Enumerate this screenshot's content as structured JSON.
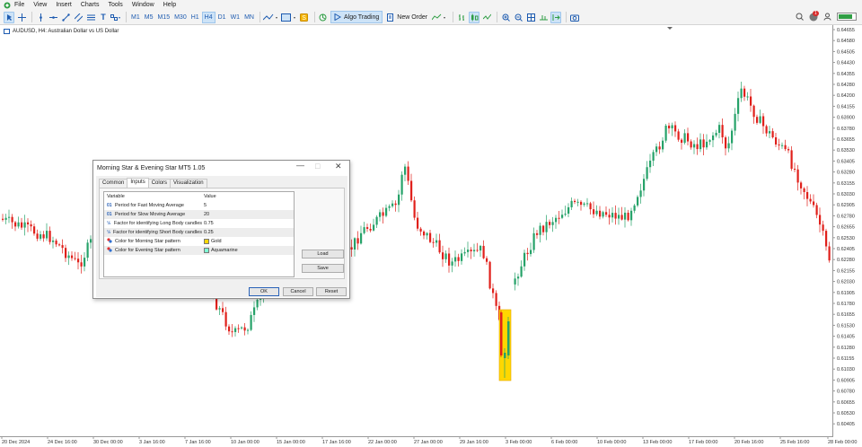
{
  "menu": {
    "items": [
      "File",
      "View",
      "Insert",
      "Charts",
      "Tools",
      "Window",
      "Help"
    ]
  },
  "toolbar": {
    "timeframes": [
      "M1",
      "M5",
      "M15",
      "M30",
      "H1",
      "H4",
      "D1",
      "W1",
      "MN"
    ],
    "selected_timeframe": "H4",
    "algo_trading_label": "Algo Trading",
    "new_order_label": "New Order",
    "notification_count": "1"
  },
  "chart": {
    "symbol_label": "AUDUSD, H4:  Australian Dollar vs US Dollar",
    "price_ticks": [
      "0.64655",
      "0.64580",
      "0.64505",
      "0.64430",
      "0.64355",
      "0.64280",
      "0.64200",
      "0.64155",
      "0.63900",
      "0.63780",
      "0.63655",
      "0.63530",
      "0.63405",
      "0.63280",
      "0.63155",
      "0.63030",
      "0.62905",
      "0.62780",
      "0.62655",
      "0.62530",
      "0.62405",
      "0.62280",
      "0.62155",
      "0.62030",
      "0.61905",
      "0.61780",
      "0.61655",
      "0.61530",
      "0.61405",
      "0.61280",
      "0.61155",
      "0.61030",
      "0.60905",
      "0.60780",
      "0.60655",
      "0.60530",
      "0.60405"
    ],
    "time_ticks": [
      "20 Dec 2024",
      "24 Dec 16:00",
      "30 Dec 00:00",
      "3 Jan 16:00",
      "7 Jan 16:00",
      "10 Jan 00:00",
      "15 Jan 00:00",
      "17 Jan 16:00",
      "22 Jan 00:00",
      "27 Jan 00:00",
      "29 Jan 16:00",
      "3 Feb 00:00",
      "6 Feb 00:00",
      "10 Feb 00:00",
      "13 Feb 00:00",
      "17 Feb 00:00",
      "20 Feb 16:00",
      "25 Feb 16:00",
      "28 Feb 00:00"
    ],
    "colors": {
      "bull": "#26a269",
      "bear": "#e0201b",
      "highlight": "#ffd700",
      "highlight_edge": "#e8a500"
    }
  },
  "dialog": {
    "title": "Morning Star & Evening Star MT5 1.05",
    "tabs": [
      "Common",
      "Inputs",
      "Colors",
      "Visualization"
    ],
    "active_tab": "Inputs",
    "columns": [
      "Variable",
      "Value"
    ],
    "rows": [
      {
        "icon": "01",
        "variable": "Period for Fast Moving Average",
        "value": "5"
      },
      {
        "icon": "01",
        "variable": "Period for Slow Moving Average",
        "value": "20"
      },
      {
        "icon": "½",
        "variable": "Factor for identifying Long Body candles",
        "value": "0.75"
      },
      {
        "icon": "½",
        "variable": "Factor for identifying Short Body candles",
        "value": "0.25"
      },
      {
        "icon": "color",
        "variable": "Color for Morning Star pattern",
        "value": "Gold",
        "swatch": "#ffd700"
      },
      {
        "icon": "color",
        "variable": "Color for Evening Star pattern",
        "value": "Aquamarine",
        "swatch": "#7fffd4"
      }
    ],
    "load_label": "Load",
    "save_label": "Save",
    "ok_label": "OK",
    "cancel_label": "Cancel",
    "reset_label": "Reset"
  }
}
